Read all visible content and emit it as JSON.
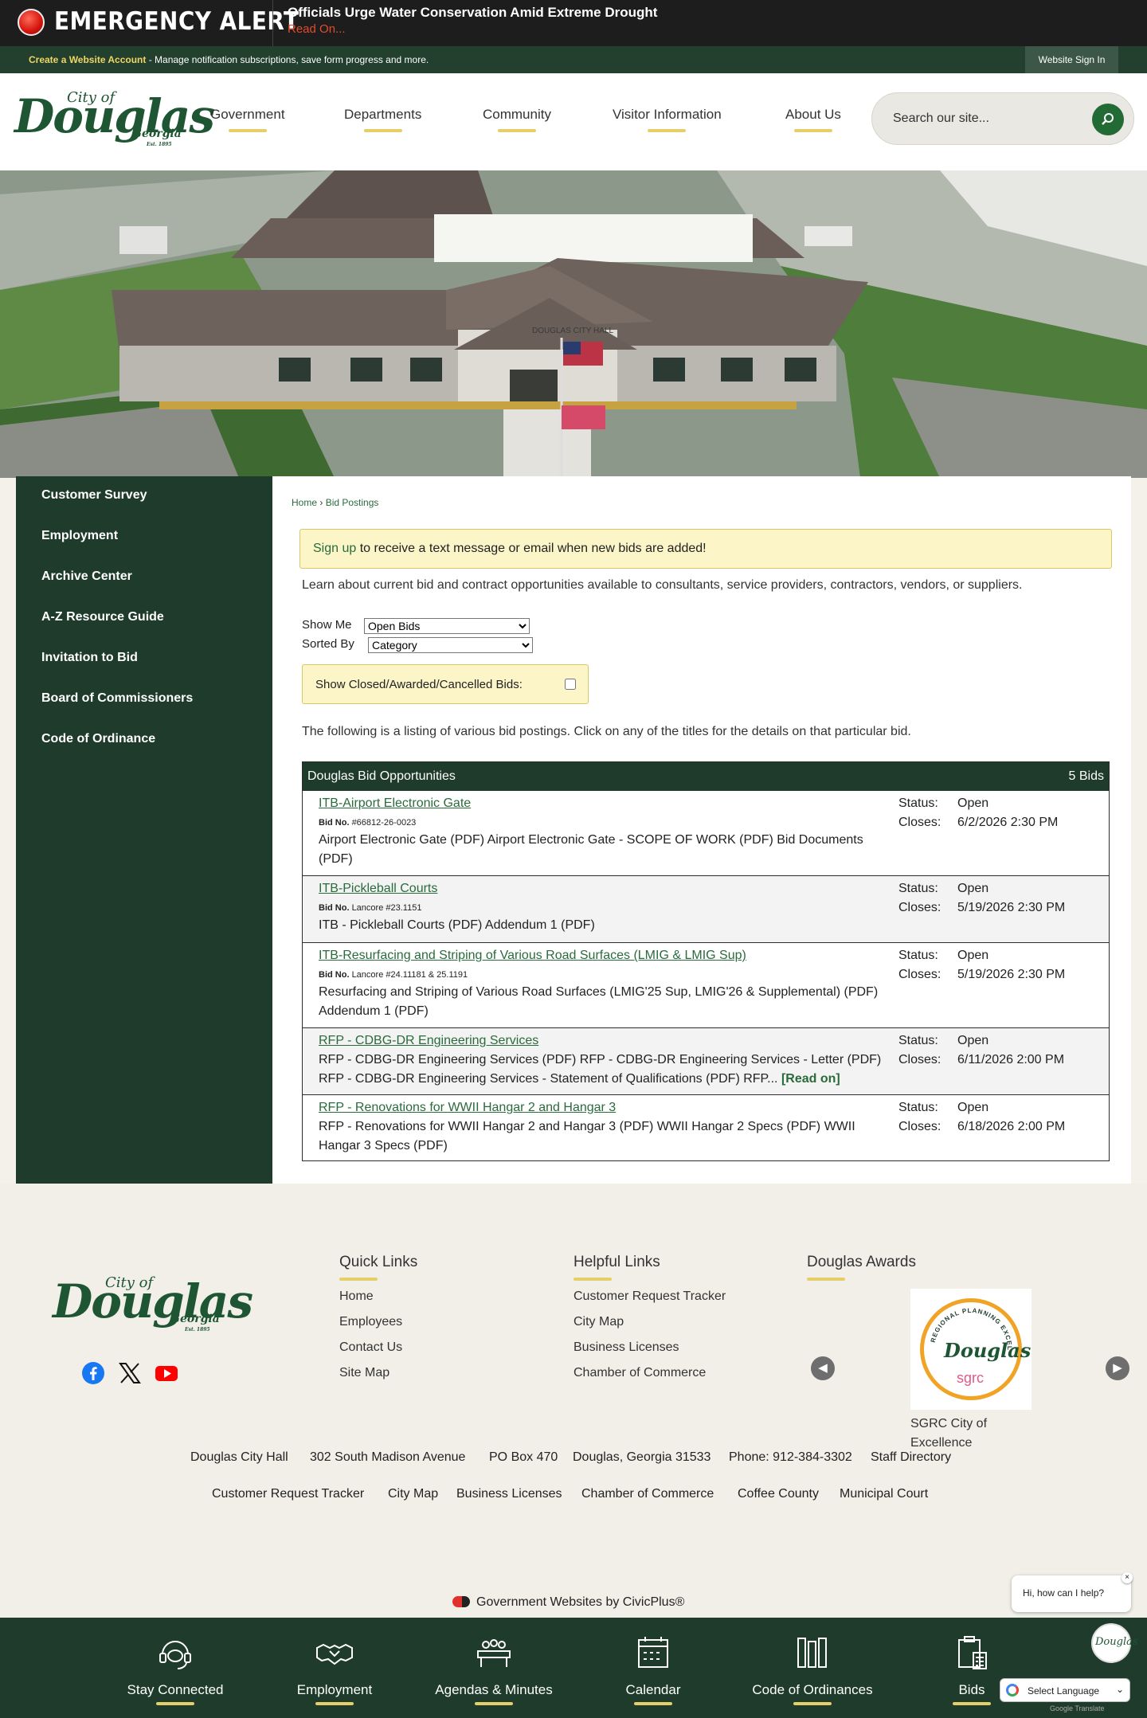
{
  "alert": {
    "title": "EMERGENCY ALERT",
    "headline": "Officials Urge Water Conservation Amid Extreme Drought",
    "read_on": "Read On..."
  },
  "account_bar": {
    "create": "Create a Website Account",
    "text": " - Manage notification subscriptions, save form progress and more.",
    "sign_in": "Website Sign In"
  },
  "logo": {
    "city_of": "City of",
    "name": "Douglas",
    "state": "Georgia",
    "est": "Est. 1895"
  },
  "nav": [
    "Government",
    "Departments",
    "Community",
    "Visitor Information",
    "About Us"
  ],
  "search": {
    "placeholder": "Search our site..."
  },
  "hero": {
    "building_sign": "DOUGLAS CITY HALL"
  },
  "sidebar": [
    "Customer Survey",
    "Employment",
    "Archive Center",
    "A-Z Resource Guide",
    "Invitation to Bid",
    "Board of Commissioners",
    "Code of Ordinance"
  ],
  "breadcrumb": {
    "home": "Home",
    "sep": "›",
    "current": "Bid Postings"
  },
  "notice": {
    "link": "Sign up",
    "text": " to receive a text message or email when new bids are added!"
  },
  "intro": "Learn about current bid and contract opportunities available to consultants, service providers, contractors, vendors, or suppliers.",
  "filters": {
    "show_me_label": "Show Me",
    "show_me_value": "Open Bids",
    "sorted_by_label": "Sorted By",
    "sorted_by_value": "Category",
    "closed_label": "Show Closed/Awarded/Cancelled Bids:"
  },
  "listing_text": "The following is a listing of various bid postings. Click on any of the titles for the details on that particular bid.",
  "bids": {
    "header": "Douglas Bid Opportunities",
    "count": "5 Bids",
    "status_label": "Status:",
    "closes_label": "Closes:",
    "bid_no_label": "Bid No.",
    "items": [
      {
        "title": "ITB-Airport Electronic Gate",
        "bid_no": "#66812-26-0023",
        "desc": "Airport Electronic Gate (PDF) Airport Electronic Gate - SCOPE OF WORK (PDF) Bid Documents (PDF)",
        "status": "Open",
        "closes": "6/2/2026 2:30 PM"
      },
      {
        "title": "ITB-Pickleball Courts",
        "bid_no": "Lancore #23.1151",
        "desc": "ITB - Pickleball Courts (PDF) Addendum 1 (PDF)",
        "status": "Open",
        "closes": "5/19/2026 2:30 PM"
      },
      {
        "title": "ITB-Resurfacing and Striping of Various Road Surfaces (LMIG & LMIG Sup)",
        "bid_no": "Lancore #24.11181 & 25.1191",
        "desc": "Resurfacing and Striping of Various Road Surfaces (LMIG'25 Sup, LMIG'26 & Supplemental) (PDF) Addendum 1 (PDF)",
        "status": "Open",
        "closes": "5/19/2026 2:30 PM"
      },
      {
        "title": "RFP - CDBG-DR Engineering Services",
        "bid_no": "",
        "desc": "RFP - CDBG-DR Engineering Services (PDF) RFP - CDBG-DR Engineering Services - Letter (PDF) RFP - CDBG-DR Engineering Services - Statement of Qualifications (PDF) RFP...",
        "read_on": "[Read on]",
        "status": "Open",
        "closes": "6/11/2026 2:00 PM"
      },
      {
        "title": "RFP - Renovations for WWII Hangar 2 and Hangar 3",
        "bid_no": "",
        "desc": "RFP - Renovations for WWII Hangar 2 and Hangar 3 (PDF) WWII Hangar 2 Specs (PDF) WWII Hangar 3 Specs (PDF)",
        "status": "Open",
        "closes": "6/18/2026 2:00 PM"
      }
    ]
  },
  "footer": {
    "quick_links_title": "Quick Links",
    "quick_links": [
      "Home",
      "Employees",
      "Contact Us",
      "Site Map"
    ],
    "helpful_links_title": "Helpful Links",
    "helpful_links": [
      "Customer Request Tracker",
      "City Map",
      "Business Licenses",
      "Chamber of Commerce"
    ],
    "awards_title": "Douglas Awards",
    "award_caption": "SGRC City of Excellence",
    "award_ring_text": "REGIONAL PLANNING EXCELLENCE",
    "award_brand": "sgrc",
    "address": [
      "Douglas City Hall",
      "302 South Madison Avenue",
      "PO Box 470",
      "Douglas, Georgia 31533",
      "Phone: 912-384-3302",
      "Staff Directory"
    ],
    "links_row": [
      "Customer Request Tracker",
      "City Map",
      "Business Licenses",
      "Chamber of Commerce",
      "Coffee County",
      "Municipal Court"
    ],
    "civicplus": "Government Websites by CivicPlus®"
  },
  "chat": {
    "text": "Hi, how can I help?",
    "close": "×"
  },
  "bottom_bar": [
    "Stay Connected",
    "Employment",
    "Agendas & Minutes",
    "Calendar",
    "Code of Ordinances",
    "Bids"
  ],
  "language": {
    "label": "Select Language",
    "powered": "Google Translate"
  },
  "colors": {
    "brand_green": "#1e3b2b",
    "accent_yellow": "#e6cf69",
    "alert_red": "#e34b2b",
    "link_green": "#2a6b3c"
  }
}
